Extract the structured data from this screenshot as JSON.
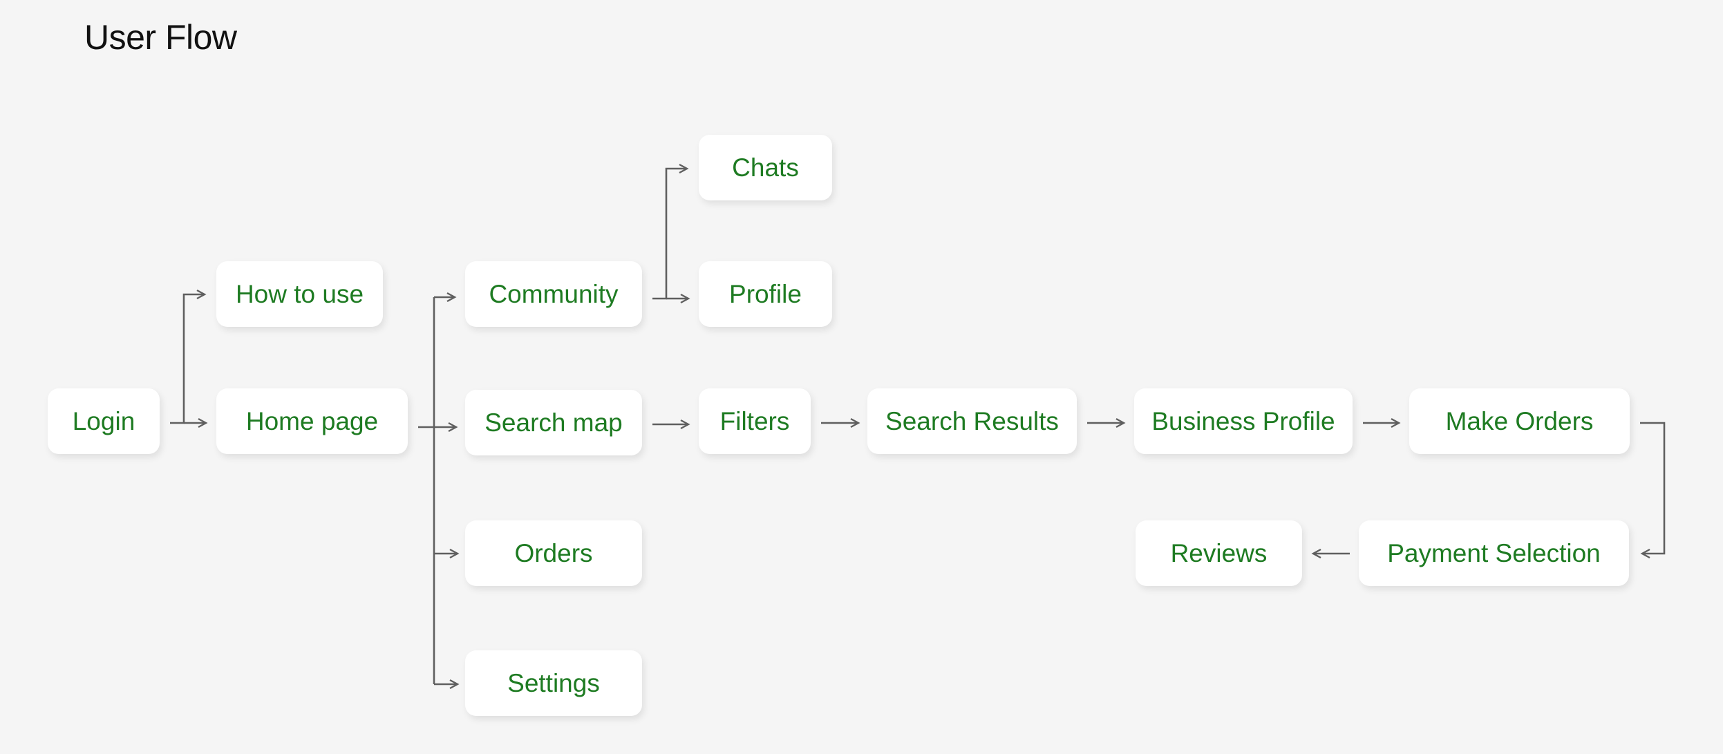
{
  "title": "User Flow",
  "colors": {
    "background": "#f5f5f5",
    "node_fill": "#ffffff",
    "node_text": "#1e7b22",
    "connector": "#5f5f5f",
    "title_text": "#111111"
  },
  "nodes": {
    "login": "Login",
    "how_to_use": "How to use",
    "home_page": "Home page",
    "community": "Community",
    "search_map": "Search map",
    "orders": "Orders",
    "settings": "Settings",
    "chats": "Chats",
    "profile": "Profile",
    "filters": "Filters",
    "search_results": "Search Results",
    "business_profile": "Business Profile",
    "make_orders": "Make Orders",
    "payment_selection": "Payment Selection",
    "reviews": "Reviews"
  },
  "edges": [
    [
      "Login",
      "How to use"
    ],
    [
      "Login",
      "Home page"
    ],
    [
      "Home page",
      "Community"
    ],
    [
      "Home page",
      "Search map"
    ],
    [
      "Home page",
      "Orders"
    ],
    [
      "Home page",
      "Settings"
    ],
    [
      "Community",
      "Chats"
    ],
    [
      "Community",
      "Profile"
    ],
    [
      "Search map",
      "Filters"
    ],
    [
      "Filters",
      "Search Results"
    ],
    [
      "Search Results",
      "Business Profile"
    ],
    [
      "Business Profile",
      "Make Orders"
    ],
    [
      "Make Orders",
      "Payment Selection"
    ],
    [
      "Payment Selection",
      "Reviews"
    ]
  ]
}
